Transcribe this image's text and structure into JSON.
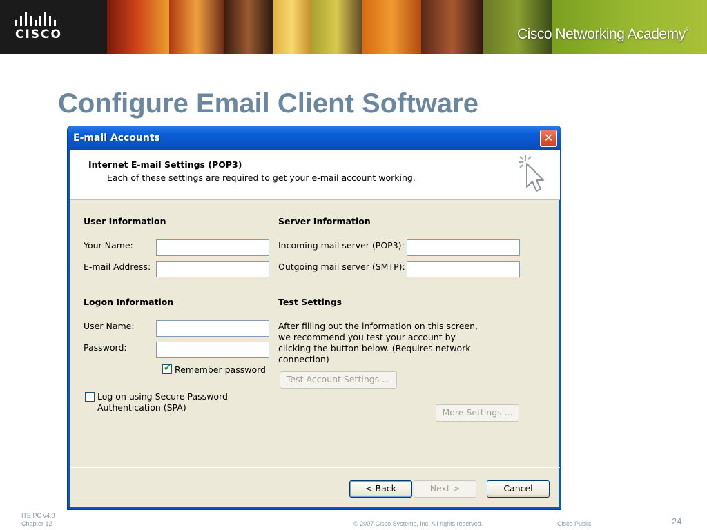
{
  "banner": {
    "logo_text": "CISCO",
    "academy_text": "Cisco Networking Academy",
    "academy_mark": "®"
  },
  "slide": {
    "title": "Configure Email Client Software"
  },
  "dialog": {
    "title": "E-mail Accounts",
    "close_label": "✕",
    "header_title": "Internet E-mail Settings (POP3)",
    "header_subtitle": "Each of these settings are required to get your e-mail account working.",
    "user_info": {
      "heading": "User Information",
      "your_name_label": "Your Name:",
      "your_name_value": "",
      "email_label": "E-mail Address:",
      "email_value": ""
    },
    "server_info": {
      "heading": "Server Information",
      "incoming_label": "Incoming mail server (POP3):",
      "incoming_value": "",
      "outgoing_label": "Outgoing mail server (SMTP):",
      "outgoing_value": ""
    },
    "logon_info": {
      "heading": "Logon Information",
      "username_label": "User Name:",
      "username_value": "",
      "password_label": "Password:",
      "password_value": "",
      "remember_label": "Remember password",
      "remember_checked": true,
      "spa_label_line1": "Log on using Secure Password",
      "spa_label_line2": "Authentication (SPA)",
      "spa_checked": false
    },
    "test_settings": {
      "heading": "Test Settings",
      "description": "After filling out the information on this screen, we recommend you test your account by clicking the button below. (Requires network connection)",
      "test_button": "Test Account Settings ...",
      "more_button": "More Settings ..."
    },
    "nav": {
      "back": "< Back",
      "next": "Next >",
      "cancel": "Cancel"
    }
  },
  "footer": {
    "course": "ITE PC v4.0",
    "chapter": "Chapter 12",
    "copyright": "© 2007 Cisco Systems, Inc. All rights reserved.",
    "classification": "Cisco Public",
    "page": "24"
  },
  "colors": {
    "title": "#6b87a0",
    "titlebar": "#0a55c8",
    "dialog_bg": "#ece9d8"
  }
}
